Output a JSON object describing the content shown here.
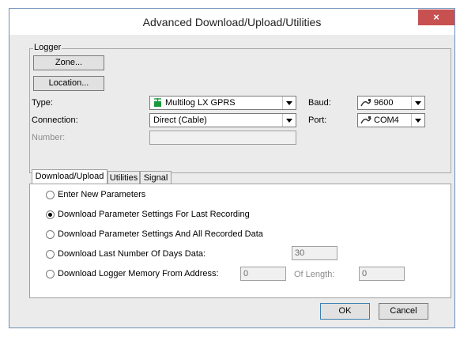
{
  "window": {
    "title": "Advanced Download/Upload/Utilities",
    "close_glyph": "×"
  },
  "logger": {
    "legend": "Logger",
    "zone_button": "Zone...",
    "location_button": "Location...",
    "type_label": "Type:",
    "type_value": "Multilog LX GPRS",
    "connection_label": "Connection:",
    "connection_value": "Direct (Cable)",
    "number_label": "Number:",
    "number_value": "",
    "baud_label": "Baud:",
    "baud_value": "9600",
    "port_label": "Port:",
    "port_value": "COM4"
  },
  "tabs": [
    {
      "label": "Download/Upload",
      "active": true
    },
    {
      "label": "Utilities",
      "active": false
    },
    {
      "label": "Signal",
      "active": false
    }
  ],
  "options": [
    {
      "label": "Enter New Parameters",
      "checked": false
    },
    {
      "label": "Download Parameter Settings For Last Recording",
      "checked": true
    },
    {
      "label": "Download Parameter Settings And All Recorded Data",
      "checked": false
    },
    {
      "label": "Download Last Number Of Days Data:",
      "checked": false
    },
    {
      "label": "Download Logger Memory From Address:",
      "checked": false
    }
  ],
  "days_value": "30",
  "address_value": "0",
  "of_length_label": "Of Length:",
  "length_value": "0",
  "footer": {
    "ok_label": "OK",
    "cancel_label": "Cancel"
  }
}
